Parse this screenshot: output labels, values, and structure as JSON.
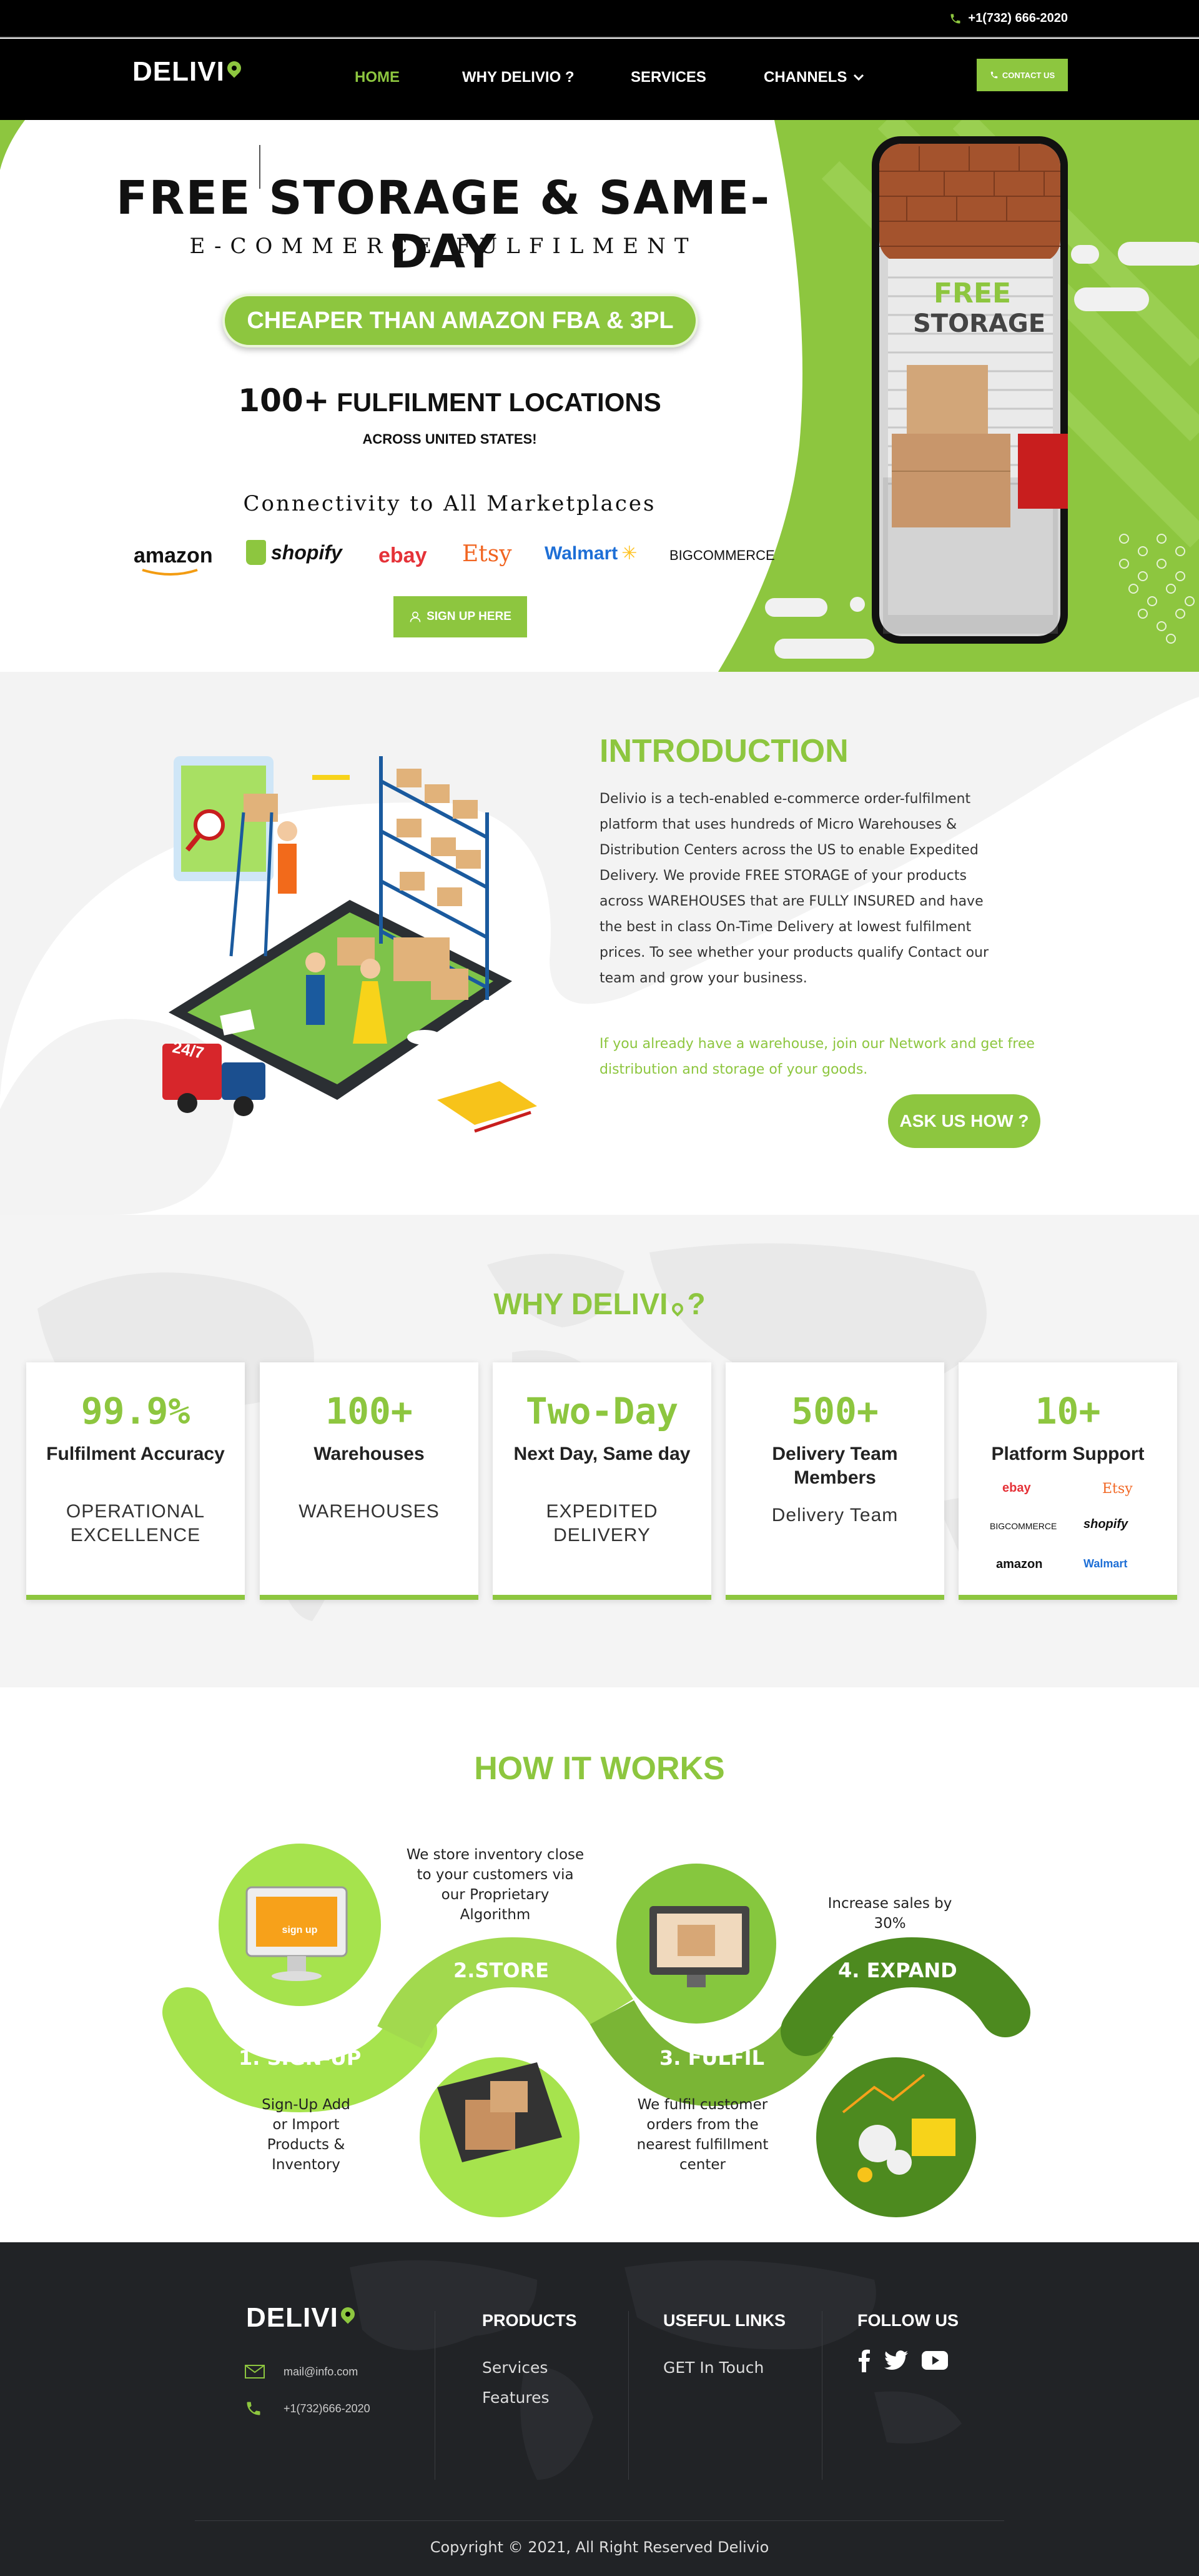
{
  "colors": {
    "accent": "#8dc63f",
    "dark": "#000000",
    "footer": "#212326"
  },
  "topbar": {
    "phone": "+1(732) 666-2020",
    "phone_icon": "phone-icon"
  },
  "nav": {
    "logo": "DELIVI",
    "items": [
      {
        "label": "HOME",
        "active": true
      },
      {
        "label": "WHY DELIVIO ?"
      },
      {
        "label": "SERVICES"
      },
      {
        "label": "CHANNELS"
      }
    ],
    "contact_button": "CONTACT US"
  },
  "hero": {
    "title": "FREE STORAGE & SAME-DAY",
    "subtitle": "E-COMMERCE FULFILMENT",
    "pill": "CHEAPER THAN AMAZON FBA & 3PL",
    "locations_count": "100+",
    "locations_label": "FULFILMENT LOCATIONS",
    "locations_sub": "ACROSS UNITED STATES!",
    "connectivity": "Connectivity to All Marketplaces",
    "marketplaces": [
      "amazon",
      "shopify",
      "ebay",
      "Etsy",
      "Walmart",
      "BIGCOMMERCE"
    ],
    "signup_button": "SIGN UP HERE",
    "phone_sign_line1": "FREE",
    "phone_sign_line2": "STORAGE"
  },
  "intro": {
    "heading": "INTRODUCTION",
    "body": "Delivio is a tech-enabled e-commerce order-fulfilment platform that uses hundreds of Micro Warehouses & Distribution Centers across the US to enable Expedited Delivery. We provide FREE STORAGE of your products across WAREHOUSES that are FULLY INSURED and have the best in class On-Time Delivery at lowest fulfilment prices. To see whether your products qualify Contact our team and grow your business.",
    "green_note": "If you already have a warehouse, join our Network and get free distribution and storage of your goods.",
    "ask_button": "ASK US HOW ?",
    "truck_label": "24/7"
  },
  "why": {
    "heading": "WHY DELIVI",
    "heading_suffix": "?",
    "cards": [
      {
        "big": "99.9%",
        "label": "Fulfilment Accuracy",
        "sub": "OPERATIONAL EXCELLENCE"
      },
      {
        "big": "100+",
        "label": "Warehouses",
        "sub": "WAREHOUSES"
      },
      {
        "big": "Two-Day",
        "label": "Next Day, Same day",
        "sub": "EXPEDITED DELIVERY"
      },
      {
        "big": "500+",
        "label": "Delivery Team Members",
        "sub": "Delivery Team"
      },
      {
        "big": "10+",
        "label": "Platform Support",
        "logos": [
          "ebay",
          "Etsy",
          "BIGCOMMERCE",
          "shopify",
          "amazon",
          "Walmart"
        ]
      }
    ]
  },
  "how": {
    "heading": "HOW IT WORKS",
    "steps": [
      {
        "label": "1. SIGN-UP",
        "text": "Sign-Up Add or Import Products & Inventory",
        "sign_badge": "sign up"
      },
      {
        "label": "2.STORE",
        "text": "We store inventory close to your customers via our Proprietary Algorithm"
      },
      {
        "label": "3. FULFIL",
        "text": "We fulfil customer orders from the nearest fulfillment center"
      },
      {
        "label": "4. EXPAND",
        "text": "Increase sales by 30%"
      }
    ]
  },
  "footer": {
    "logo": "DELIVI",
    "email": "mail@info.com",
    "phone": "+1(732)666-2020",
    "products_heading": "PRODUCTS",
    "products": [
      "Services",
      "Features"
    ],
    "useful_heading": "USEFUL LINKS",
    "useful": [
      "GET In Touch"
    ],
    "follow_heading": "FOLLOW US",
    "social": [
      "facebook-icon",
      "twitter-icon",
      "youtube-icon"
    ],
    "copyright": "Copyright © 2021, All Right Reserved Delivio"
  }
}
